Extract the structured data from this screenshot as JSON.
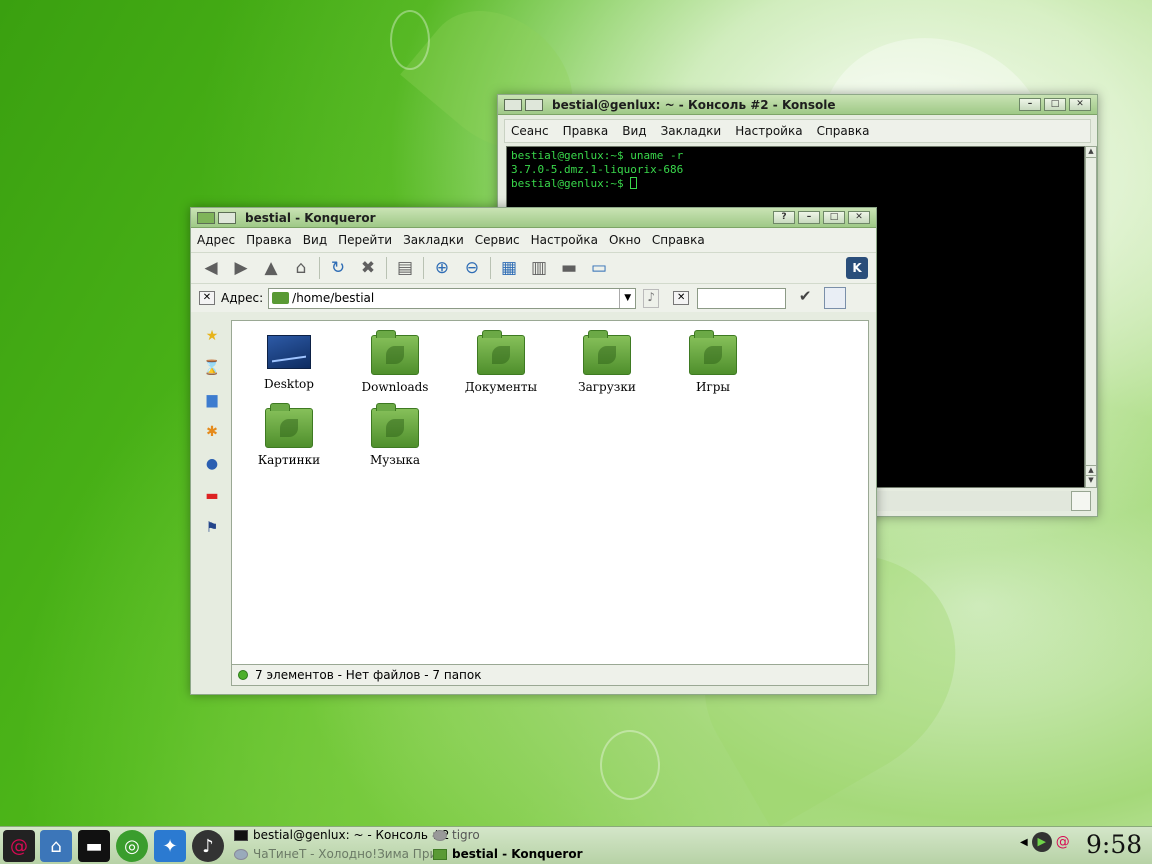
{
  "konsole": {
    "title": "bestial@genlux: ~ - Консоль #2 - Konsole",
    "menu": [
      "Сеанс",
      "Правка",
      "Вид",
      "Закладки",
      "Настройка",
      "Справка"
    ],
    "lines": [
      "bestial@genlux:~$ uname -r",
      "3.7.0-5.dmz.1-liquorix-686",
      "bestial@genlux:~$ "
    ]
  },
  "konqueror": {
    "title": "bestial - Konqueror",
    "menu": [
      "Адрес",
      "Правка",
      "Вид",
      "Перейти",
      "Закладки",
      "Сервис",
      "Настройка",
      "Окно",
      "Справка"
    ],
    "location_label": "Адрес:",
    "location_value": "/home/bestial",
    "search_value": "",
    "files": [
      {
        "name": "Desktop",
        "icon": "desktop-icon"
      },
      {
        "name": "Downloads",
        "icon": "folder-icon"
      },
      {
        "name": "Документы",
        "icon": "folder-icon"
      },
      {
        "name": "Загрузки",
        "icon": "folder-icon"
      },
      {
        "name": "Игры",
        "icon": "folder-icon"
      },
      {
        "name": "Картинки",
        "icon": "folder-icon"
      },
      {
        "name": "Музыка",
        "icon": "folder-icon"
      }
    ],
    "status": "7 элементов - Нет файлов - 7 папок"
  },
  "taskbar": {
    "tasks": [
      {
        "label": "bestial@genlux: ~ - Консоль #2"
      },
      {
        "label": "tigro"
      },
      {
        "label": "ЧаТинеТ - Холодно!Зима При"
      },
      {
        "label": "bestial - Konqueror"
      }
    ],
    "clock": "9:58"
  },
  "colors": {
    "accent": "#4caf2a",
    "terminal_fg": "#39d84b",
    "terminal_bg": "#000000"
  }
}
